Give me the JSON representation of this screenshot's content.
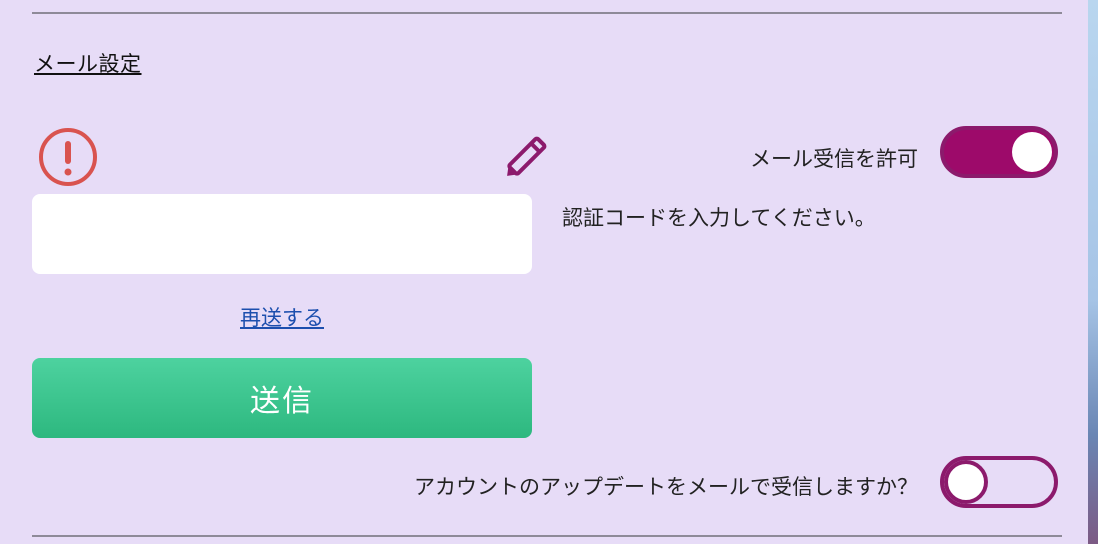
{
  "mail_settings": {
    "title": "メール設定",
    "code_input": {
      "value": "",
      "placeholder": ""
    },
    "code_hint": "認証コードを入力してください。",
    "resend_label": "再送する",
    "send_label": "送信",
    "allow_mail": {
      "label": "メール受信を許可",
      "state": "on"
    },
    "account_updates": {
      "label": "アカウントのアップデートをメールで受信しますか？",
      "state": "off"
    }
  },
  "icons": {
    "alert": "exclamation-circle-icon",
    "edit": "pencil-icon"
  },
  "colors": {
    "background": "#e7dcf7",
    "alert": "#d9534f",
    "toggle_accent": "#9d0a6a",
    "send_button": "#2fbf86",
    "link": "#1d4fae"
  }
}
